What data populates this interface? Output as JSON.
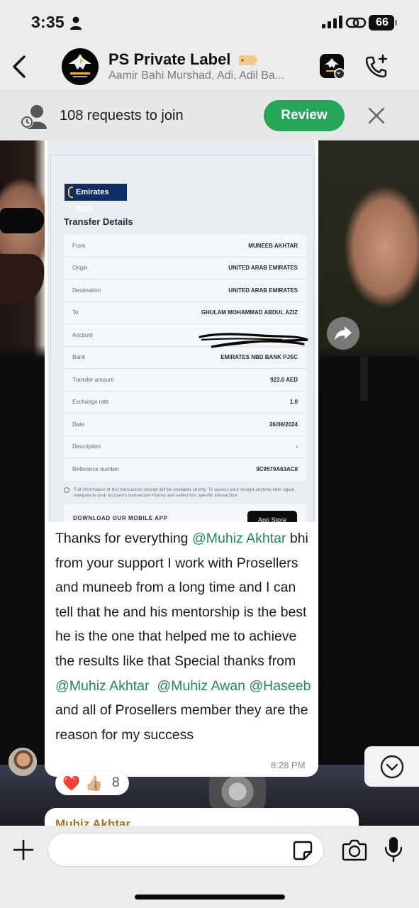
{
  "status_bar": {
    "time": "3:35",
    "battery": "66"
  },
  "header": {
    "title": "PS Private Label",
    "members": "Aamir Bahi Murshad, Adi, Adil Ba..."
  },
  "requests_banner": {
    "text": "108 requests to join",
    "review_label": "Review"
  },
  "receipt": {
    "bank_logo": "Emirates NBD",
    "title": "Transfer Details",
    "rows": [
      {
        "label": "From",
        "value": "MUNEEB AKHTAR"
      },
      {
        "label": "Origin",
        "value": "UNITED ARAB EMIRATES"
      },
      {
        "label": "Destination",
        "value": "UNITED ARAB EMIRATES"
      },
      {
        "label": "To",
        "value": "GHULAM MOHAMMAD ABDUL AZIZ"
      },
      {
        "label": "Account",
        "value": ""
      },
      {
        "label": "Bank",
        "value": "EMIRATES NBD BANK PJSC"
      },
      {
        "label": "Transfer amount",
        "value": "923.0 AED"
      },
      {
        "label": "Exchange rate",
        "value": "1.0"
      },
      {
        "label": "Date",
        "value": "26/06/2024"
      },
      {
        "label": "Description",
        "value": "-"
      },
      {
        "label": "Reference number",
        "value": "9C9579A63AC8"
      }
    ],
    "note": "Full information of this transaction receipt will be available shortly. To access your receipt anytime later again, navigate to your account's transaction history and select this specific transaction",
    "download_label": "DOWNLOAD OUR MOBILE APP",
    "app_store_label": "App Store"
  },
  "message": {
    "part1": "Thanks for everything ",
    "mention1": "@Muhiz Akhtar",
    "part2": " bhi from your support I work with Prosellers and muneeb from a long time and I can tell that he and his mentorship is the best he is the one that helped me to achieve the results like that Special thanks from ",
    "mention2": "@Muhiz Akhtar",
    "part3": "  ",
    "mention3": "@Muhiz Awan",
    "part4": " ",
    "mention4": "@Haseeb",
    "part5": " and all of Prosellers member they are the reason for my success",
    "time": "8:28 PM"
  },
  "reactions": {
    "heart": "❤️",
    "thumbs": "👍🏼",
    "count": "8"
  },
  "next_message": {
    "sender": "Muhiz Akhtar"
  },
  "composer": {
    "placeholder": ""
  },
  "colors": {
    "accent_green": "#25a557",
    "mention_green": "#1f8a5a",
    "sender_gold": "#a8741f"
  },
  "icons": [
    "status-person-icon",
    "signal-icon",
    "link-icon",
    "battery-icon",
    "back-icon",
    "tag-icon",
    "call-add-icon",
    "requests-icon",
    "close-icon",
    "forward-icon",
    "chevron-down-icon",
    "plus-icon",
    "sticker-icon",
    "camera-icon",
    "mic-icon"
  ]
}
